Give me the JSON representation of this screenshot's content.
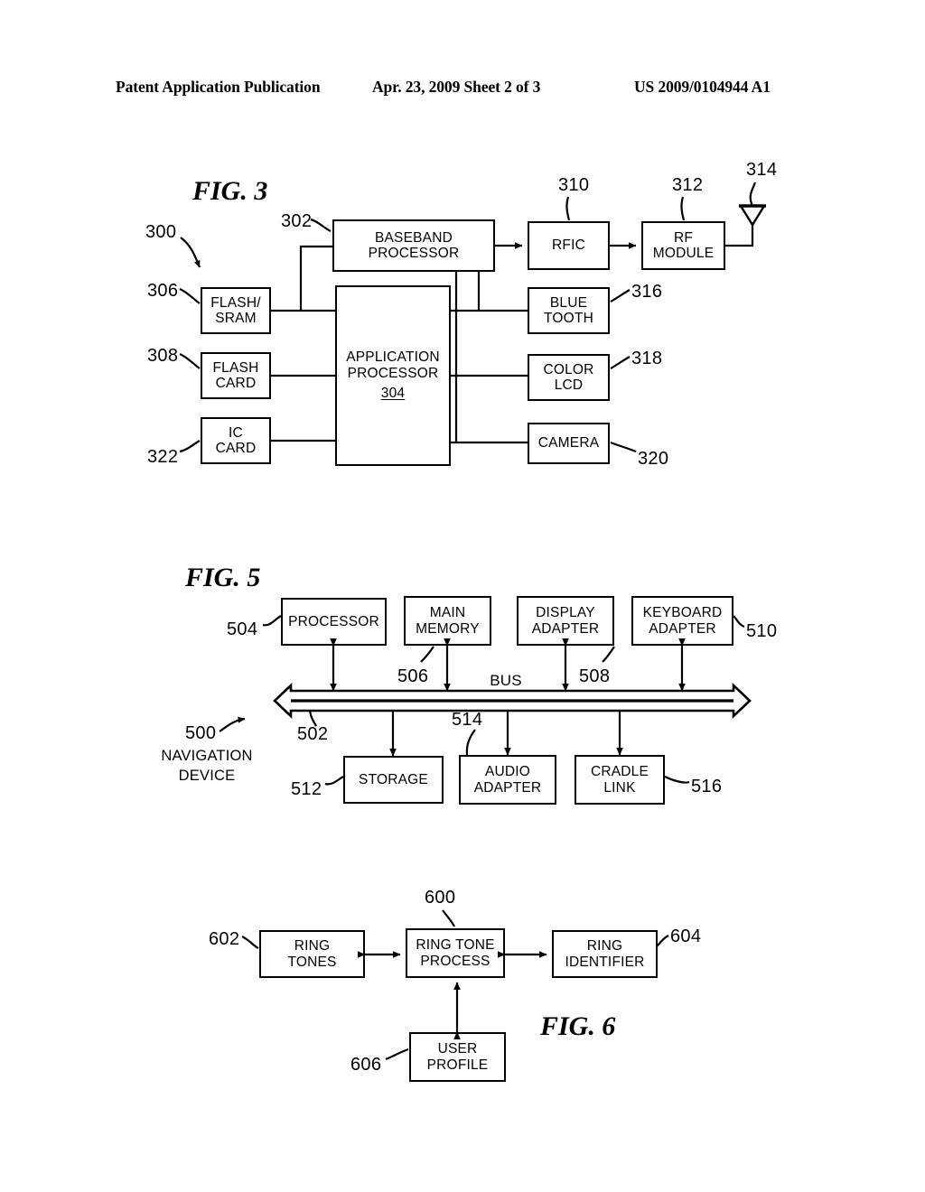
{
  "header": {
    "left": "Patent Application Publication",
    "middle": "Apr. 23, 2009  Sheet 2 of 3",
    "right": "US 2009/0104944 A1"
  },
  "figures": {
    "fig3": {
      "label": "FIG. 3",
      "system_ref": "300",
      "boxes": [
        {
          "id": "baseband",
          "lines": [
            "BASEBAND",
            "PROCESSOR"
          ],
          "ref": "302"
        },
        {
          "id": "application",
          "lines": [
            "APPLICATION",
            "PROCESSOR"
          ],
          "ref": "304",
          "ref_inside": true
        },
        {
          "id": "flash_sram",
          "lines": [
            "FLASH/",
            "SRAM"
          ],
          "ref": "306"
        },
        {
          "id": "flash_card",
          "lines": [
            "FLASH",
            "CARD"
          ],
          "ref": "308"
        },
        {
          "id": "ic_card",
          "lines": [
            "IC",
            "CARD"
          ],
          "ref": "322"
        },
        {
          "id": "rfic",
          "lines": [
            "RFIC"
          ],
          "ref": "310"
        },
        {
          "id": "rf_module",
          "lines": [
            "RF",
            "MODULE"
          ],
          "ref": "312"
        },
        {
          "id": "bluetooth",
          "lines": [
            "BLUE",
            "TOOTH"
          ],
          "ref": "316"
        },
        {
          "id": "color_lcd",
          "lines": [
            "COLOR",
            "LCD"
          ],
          "ref": "318"
        },
        {
          "id": "camera",
          "lines": [
            "CAMERA"
          ],
          "ref": "320"
        }
      ],
      "antenna_ref": "314"
    },
    "fig5": {
      "label": "FIG. 5",
      "system_ref": "500",
      "system_name_line1": "NAVIGATION",
      "system_name_line2": "DEVICE",
      "bus_label": "BUS",
      "bus_ref": "502",
      "boxes": [
        {
          "id": "processor",
          "lines": [
            "PROCESSOR"
          ],
          "ref": "504"
        },
        {
          "id": "main_memory",
          "lines": [
            "MAIN",
            "MEMORY"
          ],
          "ref": "506"
        },
        {
          "id": "display_adapter",
          "lines": [
            "DISPLAY",
            "ADAPTER"
          ],
          "ref": "508"
        },
        {
          "id": "keyboard_adapter",
          "lines": [
            "KEYBOARD",
            "ADAPTER"
          ],
          "ref": "510"
        },
        {
          "id": "storage",
          "lines": [
            "STORAGE"
          ],
          "ref": "512"
        },
        {
          "id": "audio_adapter",
          "lines": [
            "AUDIO",
            "ADAPTER"
          ],
          "ref": "514"
        },
        {
          "id": "cradle_link",
          "lines": [
            "CRADLE",
            "LINK"
          ],
          "ref": "516"
        }
      ]
    },
    "fig6": {
      "label": "FIG. 6",
      "system_ref": "600",
      "boxes": [
        {
          "id": "ring_tones",
          "lines": [
            "RING",
            "TONES"
          ],
          "ref": "602"
        },
        {
          "id": "ring_tone_process",
          "lines": [
            "RING TONE",
            "PROCESS"
          ],
          "ref": "600"
        },
        {
          "id": "ring_identifier",
          "lines": [
            "RING",
            "IDENTIFIER"
          ],
          "ref": "604"
        },
        {
          "id": "user_profile",
          "lines": [
            "USER",
            "PROFILE"
          ],
          "ref": "606"
        }
      ]
    }
  },
  "colors": {
    "ink": "#000000",
    "paper": "#ffffff"
  }
}
